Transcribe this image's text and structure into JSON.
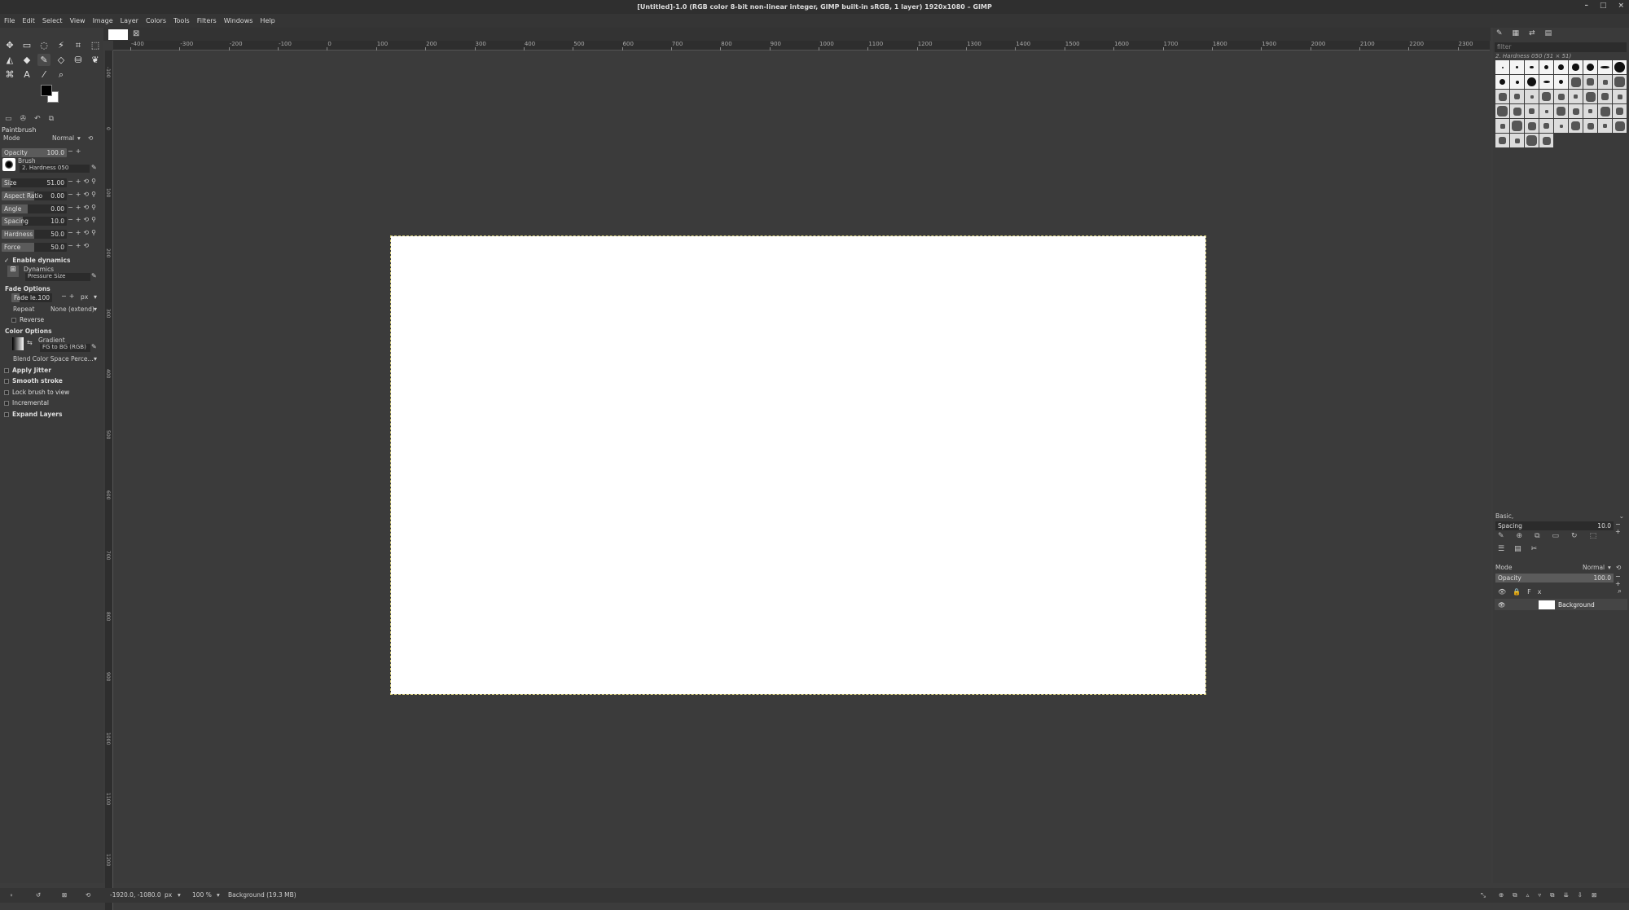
{
  "window": {
    "title": "[Untitled]-1.0 (RGB color 8-bit non-linear integer, GIMP built-in sRGB, 1 layer) 1920x1080 – GIMP",
    "controls": [
      "–",
      "□",
      "×"
    ]
  },
  "menu": [
    "File",
    "Edit",
    "Select",
    "View",
    "Image",
    "Layer",
    "Colors",
    "Tools",
    "Filters",
    "Windows",
    "Help"
  ],
  "tool_options": {
    "title": "Paintbrush",
    "mode_label": "Mode",
    "mode_value": "Normal",
    "opacity_label": "Opacity",
    "opacity_value": "100.0",
    "opacity_fraction": 1.0,
    "brush_label": "Brush",
    "brush_value": "2. Hardness 050",
    "size_label": "Size",
    "size_value": "51.00",
    "aspect_label": "Aspect Ratio",
    "aspect_value": "0.00",
    "angle_label": "Angle",
    "angle_value": "0.00",
    "spacing_label": "Spacing",
    "spacing_value": "10.0",
    "hardness_label": "Hardness",
    "hardness_value": "50.0",
    "force_label": "Force",
    "force_value": "50.0",
    "enable_dynamics": "Enable dynamics",
    "dynamics_label": "Dynamics",
    "dynamics_value": "Pressure Size",
    "fade_options": "Fade Options",
    "fade_length_label": "Fade le...",
    "fade_length_value": "100",
    "fade_unit": "px",
    "repeat_label": "Repeat",
    "repeat_value": "None (extend)",
    "reverse": "Reverse",
    "color_options": "Color Options",
    "gradient_label": "Gradient",
    "gradient_value": "FG to BG (RGB)",
    "blend_space": "Blend Color Space Perce...",
    "apply_jitter": "Apply Jitter",
    "smooth_stroke": "Smooth stroke",
    "lock_brush": "Lock brush to view",
    "incremental": "Incremental",
    "expand_layers": "Expand Layers"
  },
  "rulers": {
    "h_marks": [
      "-400",
      "-300",
      "-200",
      "-100",
      "0",
      "100",
      "200",
      "300",
      "400",
      "500",
      "600",
      "700",
      "800",
      "900",
      "1000",
      "1100",
      "1200",
      "1300",
      "1400",
      "1500",
      "1600",
      "1700",
      "1800",
      "1900",
      "2000",
      "2100",
      "2200",
      "2300"
    ],
    "v_marks": [
      "-100",
      "0",
      "100",
      "200",
      "300",
      "400",
      "500",
      "600",
      "700",
      "800",
      "900",
      "1000",
      "1100",
      "1200"
    ]
  },
  "brushes": {
    "filter_placeholder": "filter",
    "selected": "2. Hardness 050 (51 × 51)",
    "preset": "Basic,",
    "spacing_label": "Spacing",
    "spacing_value": "10.0"
  },
  "layers": {
    "mode_label": "Mode",
    "mode_value": "Normal",
    "opacity_label": "Opacity",
    "opacity_value": "100.0",
    "layer_name": "Background"
  },
  "status": {
    "coords": "-1920.0, -1080.0",
    "unit": "px",
    "zoom": "100 %",
    "info": "Background (19.3 MB)"
  }
}
